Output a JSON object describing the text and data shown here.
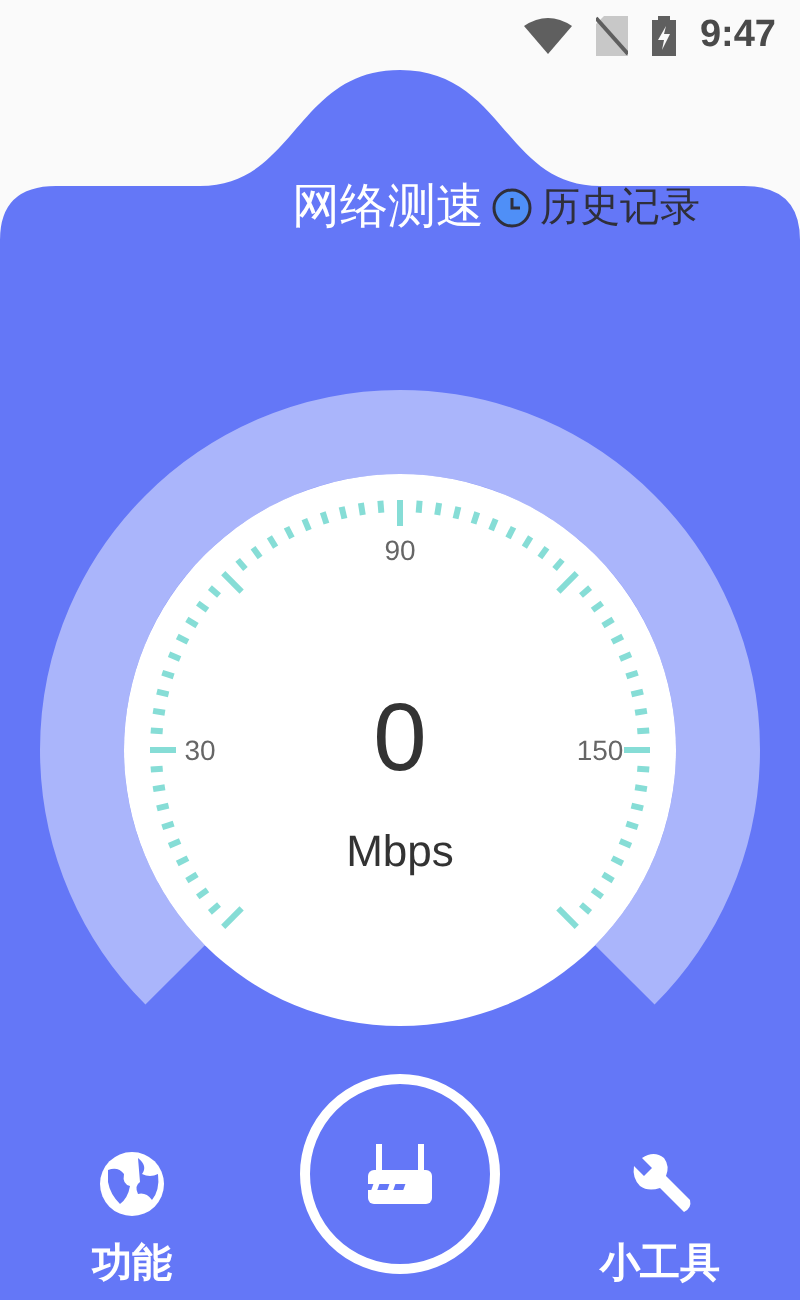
{
  "status_bar": {
    "time": "9:47"
  },
  "header": {
    "title": "网络测速",
    "history_label": "历史记录"
  },
  "gauge": {
    "value": "0",
    "unit": "Mbps",
    "scale_labels": [
      "30",
      "90",
      "150"
    ]
  },
  "bottom_nav": [
    {
      "kind": "globe",
      "label": "功能"
    },
    {
      "kind": "router"
    },
    {
      "kind": "wrench",
      "label": "小工具"
    }
  ]
}
